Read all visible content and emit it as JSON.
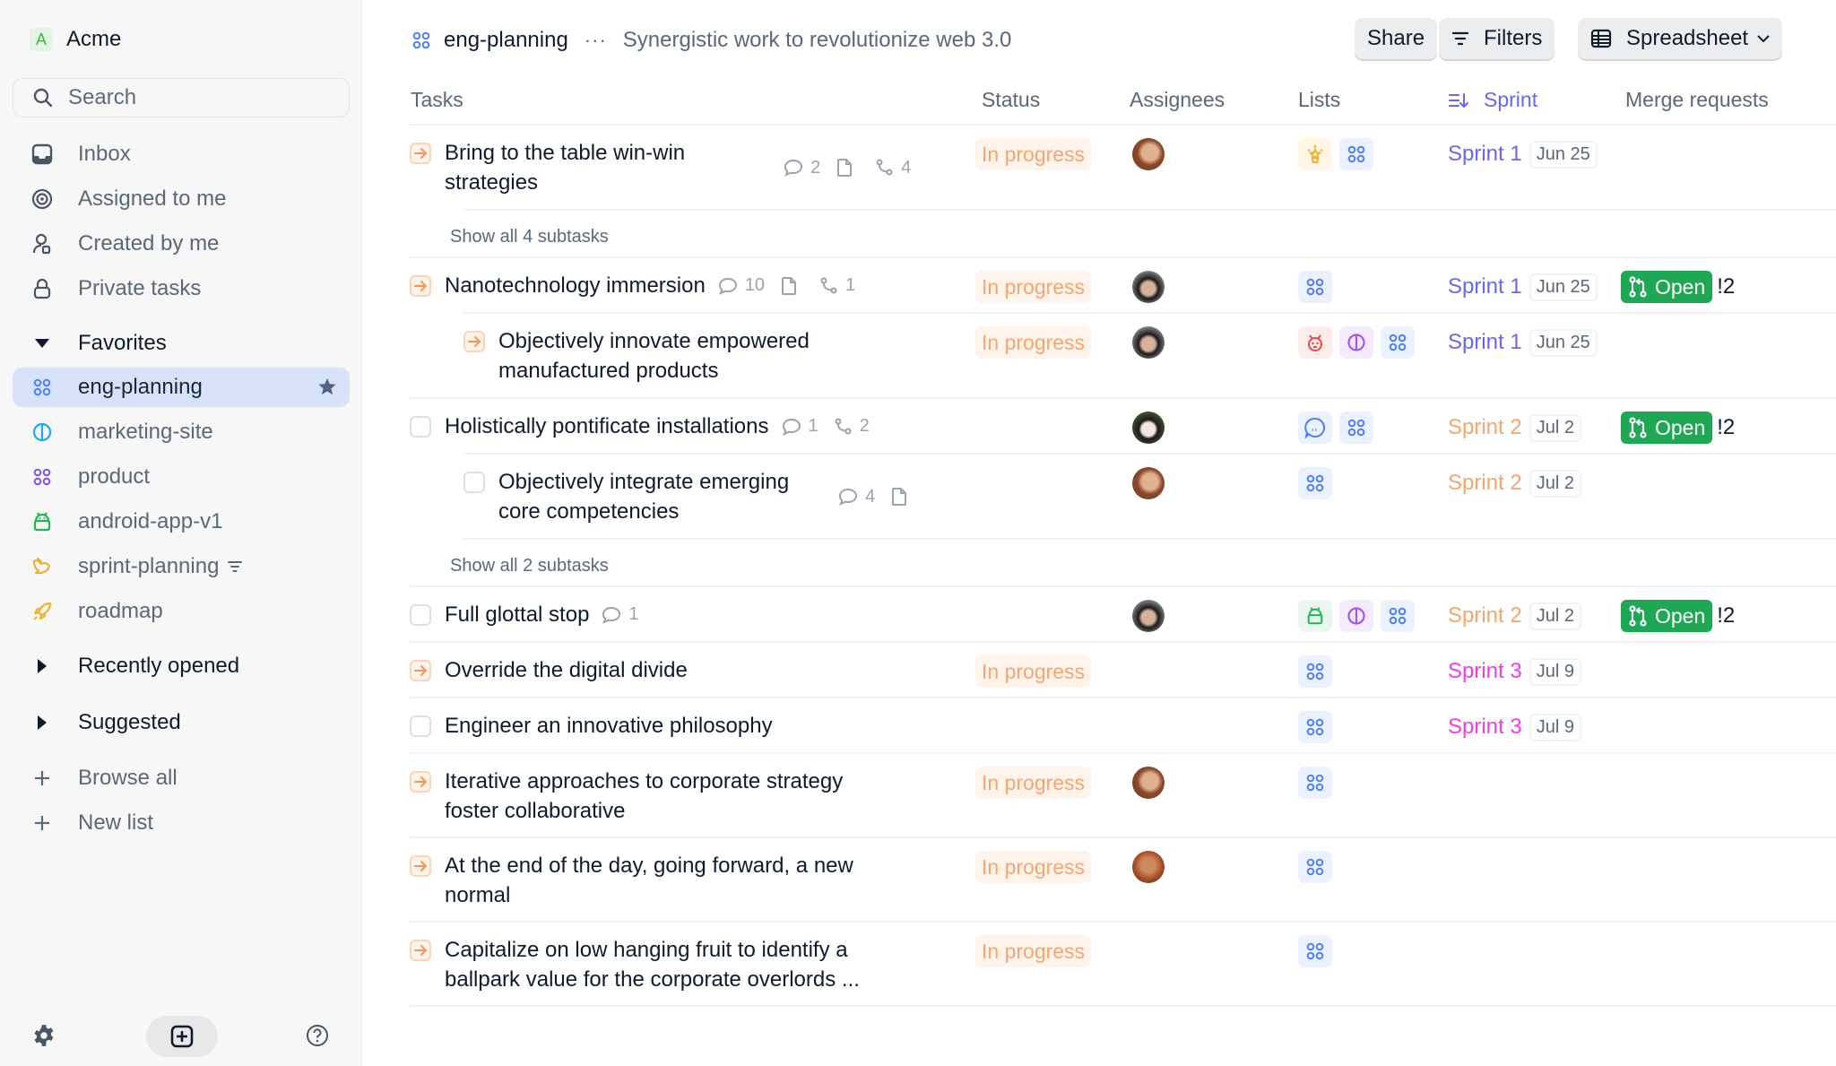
{
  "workspace": {
    "initial": "A",
    "name": "Acme"
  },
  "search": {
    "placeholder": "Search"
  },
  "nav": [
    {
      "label": "Inbox",
      "icon": "inbox-icon"
    },
    {
      "label": "Assigned to me",
      "icon": "target-icon"
    },
    {
      "label": "Created by me",
      "icon": "user-created-icon"
    },
    {
      "label": "Private tasks",
      "icon": "lock-icon"
    }
  ],
  "favorites": {
    "label": "Favorites",
    "items": [
      {
        "label": "eng-planning",
        "icon": "grid-icon",
        "color": "#4f7ff7",
        "active": true,
        "starred": true
      },
      {
        "label": "marketing-site",
        "icon": "half-circle-icon",
        "color": "#1ea6f0"
      },
      {
        "label": "product",
        "icon": "grid-icon",
        "color": "#7b54f0"
      },
      {
        "label": "android-app-v1",
        "icon": "android-icon",
        "color": "#22b455"
      },
      {
        "label": "sprint-planning",
        "icon": "rabbit-icon",
        "color": "#f0b030",
        "filtered": true
      },
      {
        "label": "roadmap",
        "icon": "rocket-icon",
        "color": "#f0b030"
      }
    ]
  },
  "sections": [
    {
      "label": "Recently opened"
    },
    {
      "label": "Suggested"
    }
  ],
  "actions": [
    {
      "label": "Browse all"
    },
    {
      "label": "New list"
    }
  ],
  "header": {
    "title": "eng-planning",
    "more": "···",
    "description": "Synergistic work to revolutionize web 3.0",
    "share": "Share",
    "filters": "Filters",
    "view": "Spreadsheet"
  },
  "columns": {
    "tasks": "Tasks",
    "status": "Status",
    "assignees": "Assignees",
    "lists": "Lists",
    "sprint": "Sprint",
    "merge_requests": "Merge requests"
  },
  "colors": {
    "sprint1": "#6a66f5",
    "sprint2": "#f5a56e",
    "sprint3": "#f03ee6",
    "in_progress": "#f5a56e",
    "open_mr": "#1ea853"
  },
  "rows": [
    {
      "title_lines": [
        "Bring to the table win-win",
        "strategies"
      ],
      "state": "in-progress",
      "status": "In progress",
      "comments": "2",
      "doc": true,
      "links": "4",
      "avatar": "a",
      "lists": [
        "idea",
        "grid"
      ],
      "sprint": "Sprint 1",
      "sprint_key": "sprint1",
      "date": "Jun 25"
    },
    {
      "show_subtasks": "Show all 4 subtasks"
    },
    {
      "title_lines": [
        "Nanotechnology immersion"
      ],
      "state": "in-progress",
      "status": "In progress",
      "comments": "10",
      "doc": true,
      "links": "1",
      "avatar": "b",
      "lists": [
        "grid"
      ],
      "sprint": "Sprint 1",
      "sprint_key": "sprint1",
      "date": "Jun 25",
      "mr": "Open",
      "mr_num": "!2"
    },
    {
      "sub": true,
      "title_lines": [
        "Objectively innovate empowered",
        "manufactured products"
      ],
      "state": "in-progress",
      "status": "In progress",
      "avatar": "b",
      "lists": [
        "bug",
        "half",
        "grid"
      ],
      "sprint": "Sprint 1",
      "sprint_key": "sprint1",
      "date": "Jun 25"
    },
    {
      "title_lines": [
        "Holistically pontificate installations"
      ],
      "state": "todo",
      "comments": "1",
      "links": "2",
      "avatar": "c",
      "lists": [
        "quote",
        "grid"
      ],
      "sprint": "Sprint 2",
      "sprint_key": "sprint2",
      "date": "Jul 2",
      "mr": "Open",
      "mr_num": "!2"
    },
    {
      "sub": true,
      "title_lines": [
        "Objectively integrate emerging",
        "core competencies"
      ],
      "state": "todo",
      "comments": "4",
      "doc": true,
      "avatar": "a",
      "lists": [
        "grid"
      ],
      "sprint": "Sprint 2",
      "sprint_key": "sprint2",
      "date": "Jul 2"
    },
    {
      "show_subtasks": "Show all 2 subtasks"
    },
    {
      "title_lines": [
        "Full glottal stop"
      ],
      "state": "todo",
      "comments": "1",
      "avatar": "b",
      "lists": [
        "android",
        "half",
        "grid"
      ],
      "sprint": "Sprint 2",
      "sprint_key": "sprint2",
      "date": "Jul 2",
      "mr": "Open",
      "mr_num": "!2"
    },
    {
      "title_lines": [
        "Override the digital divide"
      ],
      "state": "in-progress",
      "status": "In progress",
      "lists": [
        "grid"
      ],
      "sprint": "Sprint 3",
      "sprint_key": "sprint3",
      "date": "Jul 9"
    },
    {
      "title_lines": [
        "Engineer an innovative philosophy"
      ],
      "state": "todo",
      "lists": [
        "grid"
      ],
      "sprint": "Sprint 3",
      "sprint_key": "sprint3",
      "date": "Jul 9"
    },
    {
      "title_lines": [
        "Iterative approaches to corporate strategy",
        "foster collaborative"
      ],
      "state": "in-progress",
      "status": "In progress",
      "avatar": "a",
      "lists": [
        "grid"
      ]
    },
    {
      "title_lines": [
        "At the end of the day, going forward, a new",
        "normal"
      ],
      "state": "in-progress",
      "status": "In progress",
      "avatar": "d",
      "lists": [
        "grid"
      ]
    },
    {
      "title_lines": [
        "Capitalize on low hanging fruit to identify a",
        "ballpark value for the corporate overlords ..."
      ],
      "state": "in-progress",
      "status": "In progress",
      "lists": [
        "grid"
      ]
    }
  ]
}
